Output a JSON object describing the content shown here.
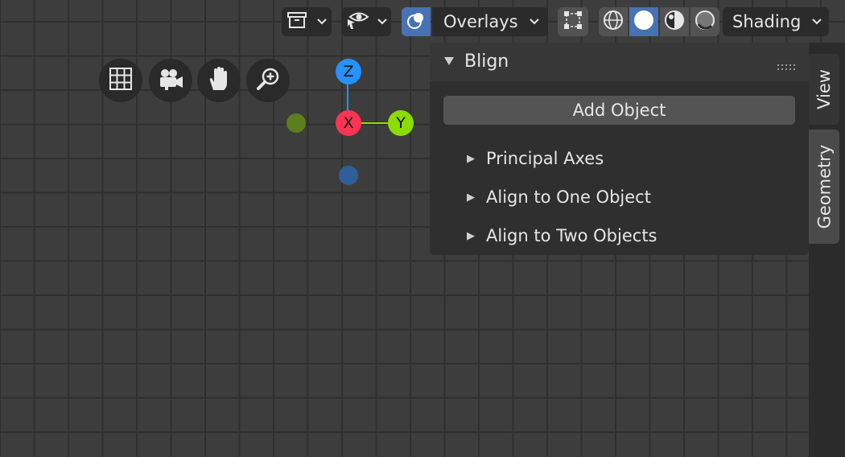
{
  "header": {
    "overlays_label": "Overlays",
    "shading_label": "Shading"
  },
  "icons": {
    "view_object_types": "box-icon",
    "selectability": "eye-cursor-icon",
    "overlays": "overlay-circles-icon",
    "xray": "xray-icon",
    "wireframe": "wireframe-sphere-icon",
    "solid": "solid-sphere-icon",
    "material": "material-sphere-icon",
    "rendered": "rendered-sphere-icon",
    "nav_grid": "grid-icon",
    "nav_camera": "camera-icon",
    "nav_hand": "hand-icon",
    "nav_zoom": "zoom-icon"
  },
  "gizmo": {
    "z": "Z",
    "x": "X",
    "y": "Y"
  },
  "panel": {
    "title": "Blign",
    "add_object_button": "Add Object",
    "subpanels": [
      "Principal Axes",
      "Align to One Object",
      "Align to Two Objects"
    ]
  },
  "sidebar_tabs": [
    "View",
    "Geometry"
  ],
  "colors": {
    "viewport_bg": "#3d3d3d",
    "grid_line": "#2f2f2f",
    "active_blue": "#4772b3",
    "axis_x": "#ff3352",
    "axis_y": "#8bdc00",
    "axis_z": "#2890ff"
  }
}
